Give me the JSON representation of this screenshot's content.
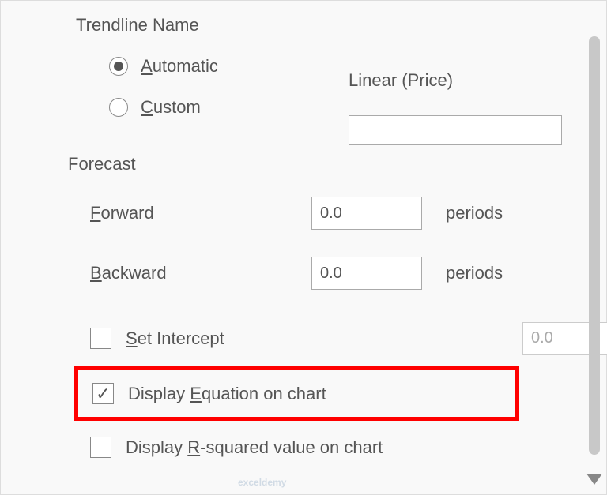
{
  "sections": {
    "trendline_name": "Trendline Name",
    "forecast": "Forecast"
  },
  "radios": {
    "automatic_prefix": "A",
    "automatic_rest": "utomatic",
    "custom_prefix": "C",
    "custom_rest": "ustom"
  },
  "display_value": "Linear (Price)",
  "forecast_fields": {
    "forward_prefix": "F",
    "forward_rest": "orward",
    "forward_value": "0.0",
    "backward_prefix": "B",
    "backward_rest": "ackward",
    "backward_value": "0.0",
    "unit": "periods"
  },
  "checks": {
    "intercept_prefix": "S",
    "intercept_rest": "et Intercept",
    "intercept_value": "0.0",
    "equation_before": "Display ",
    "equation_u": "E",
    "equation_after": "quation on chart",
    "rsquared_before": "Display ",
    "rsquared_u": "R",
    "rsquared_after": "-squared value on chart"
  },
  "watermark": "exceldemy"
}
